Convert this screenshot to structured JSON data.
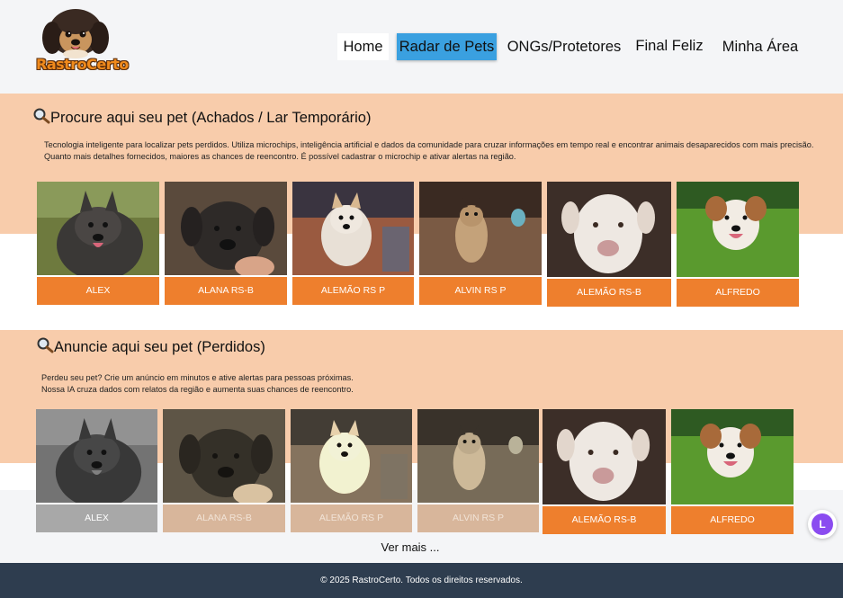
{
  "header": {
    "logo_text": "RastroCerto",
    "nav": [
      "Home",
      "Radar de Pets",
      "ONGs/Protetores",
      "Final Feliz",
      "Minha Área"
    ],
    "active": "Radar de Pets"
  },
  "found_section": {
    "title": "Procure aqui seu pet (Achados / Lar Temporário)",
    "description": "Tecnologia inteligente para localizar pets perdidos. Utiliza microchips, inteligência artificial e dados da comunidade para cruzar informações em tempo real e encontrar animais desaparecidos com mais precisão. Quanto mais detalhes fornecidos, maiores as chances de reencontro. É possível cadastrar o microchip e ativar alertas na região.",
    "pets": [
      "ALEX",
      "ALANA RS-B",
      "ALEMÃO RS P",
      "ALVIN RS P",
      "ALEMÃO RS-B",
      "ALFREDO"
    ]
  },
  "lost_section": {
    "title": "Anuncie aqui seu pet (Perdidos)",
    "description_line1": "Perdeu seu pet? Crie um anúncio em minutos e ative alertas para pessoas próximas.",
    "description_line2": "Nossa IA cruza dados com relatos da região e aumenta suas chances de reencontro.",
    "pets": [
      "ALEX",
      "ALANA RS-B",
      "ALEMÃO RS P",
      "ALVIN RS P",
      "ALEMÃO RS-B",
      "ALFREDO"
    ]
  },
  "more_label": "Ver mais ...",
  "footer_text": "© 2025 RastroCerto. Todos os direitos reservados.",
  "chat_letter": "L",
  "colors": {
    "accent_orange": "#ee7f2d",
    "section_peach": "#f8ccab",
    "nav_active": "#3aa0e0",
    "footer": "#2e3d4f",
    "chat": "#8b4cf0"
  }
}
